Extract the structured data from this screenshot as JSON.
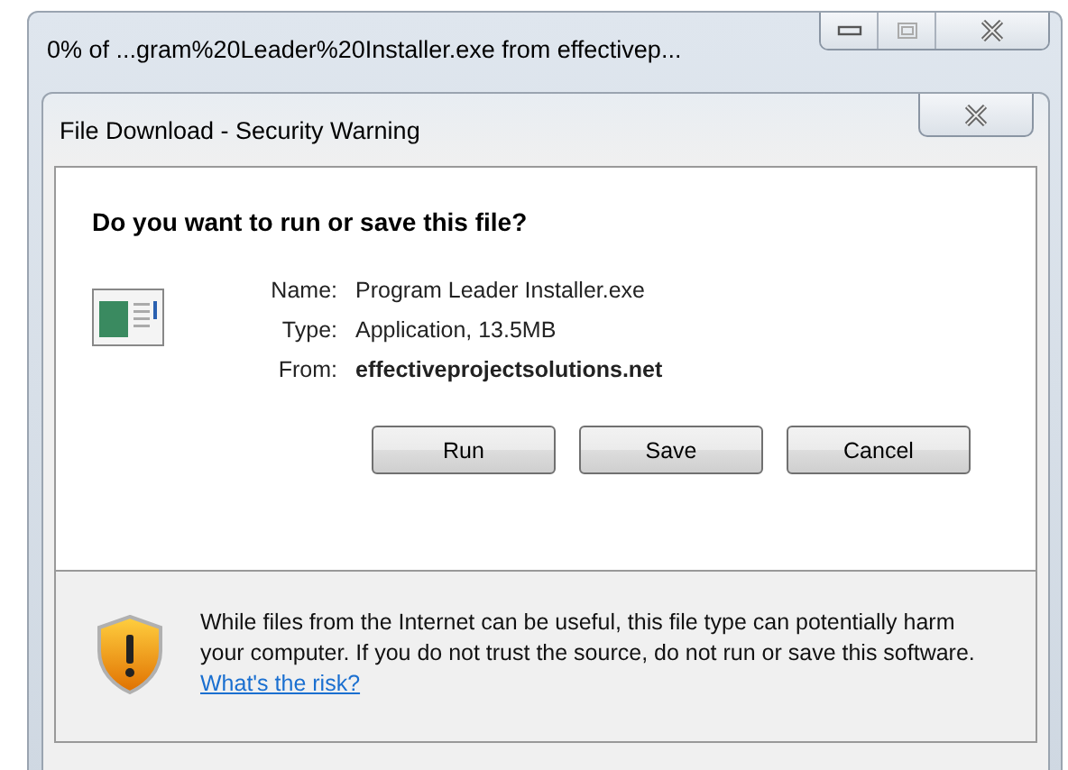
{
  "window": {
    "title": "0% of ...gram%20Leader%20Installer.exe from effectivep..."
  },
  "dialog": {
    "title": "File Download - Security Warning",
    "question": "Do you want to run or save this file?",
    "fields": [
      {
        "label": "Name:",
        "value": "Program Leader Installer.exe",
        "bold": false
      },
      {
        "label": "Type:",
        "value": "Application, 13.5MB",
        "bold": false
      },
      {
        "label": "From:",
        "value": "effectiveprojectsolutions.net",
        "bold": true
      }
    ],
    "buttons": [
      "Run",
      "Save",
      "Cancel"
    ],
    "warning": {
      "text": "While files from the Internet can be useful, this file type can potentially harm your computer. If you do not trust the source, do not run or save this software.",
      "link": "What's the risk?"
    }
  }
}
